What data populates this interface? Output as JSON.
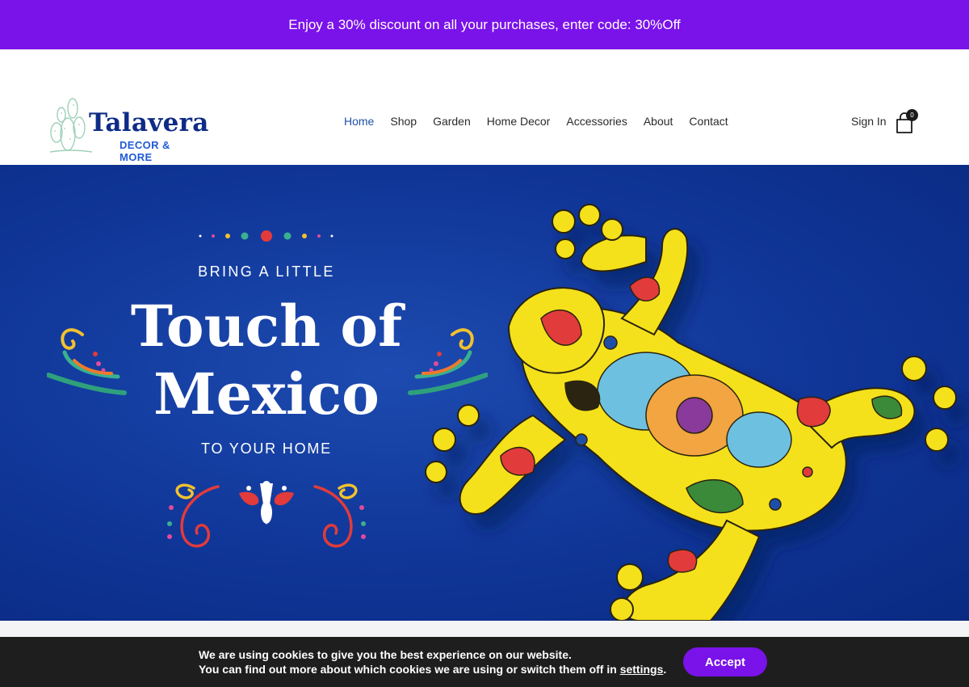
{
  "promo": {
    "text": "Enjoy a 30% discount on all your purchases, enter code: 30%Off"
  },
  "brand": {
    "name": "Talavera",
    "tagline": "DECOR & MORE"
  },
  "nav": {
    "items": [
      {
        "label": "Home",
        "active": true
      },
      {
        "label": "Shop"
      },
      {
        "label": "Garden"
      },
      {
        "label": "Home Decor"
      },
      {
        "label": "Accessories"
      },
      {
        "label": "About"
      },
      {
        "label": "Contact"
      }
    ]
  },
  "account": {
    "signin_label": "Sign In",
    "cart_count": "0",
    "cart_icon": "shopping-bag-icon"
  },
  "hero": {
    "line1": "BRING A LITTLE",
    "title_line1": "Touch of",
    "title_line2": "Mexico",
    "line2": "TO YOUR HOME",
    "image": "talavera-ceramic-frog"
  },
  "cookie": {
    "line1": "We are using cookies to give you the best experience on our website.",
    "line2_prefix": "You can find out more about which cookies we are using or switch them off in",
    "settings_link": "settings",
    "line2_suffix": ".",
    "accept_label": "Accept"
  },
  "colors": {
    "accent": "#7a12ea",
    "brand": "#0e2c86",
    "hero_bg": "#0f3597",
    "cookie_bg": "#1e1e1e"
  }
}
